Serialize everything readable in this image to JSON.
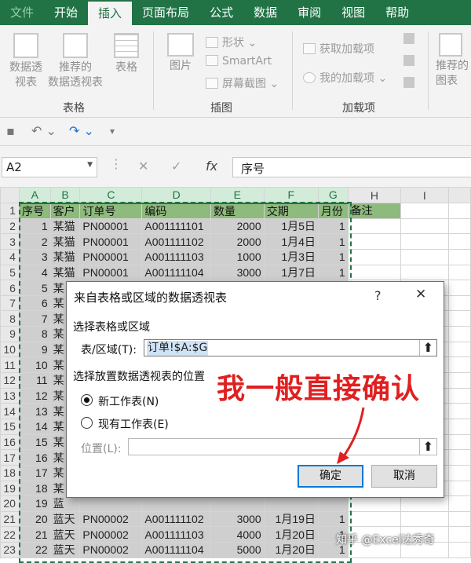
{
  "ribbon_tabs": [
    "文件",
    "开始",
    "插入",
    "页面布局",
    "公式",
    "数据",
    "审阅",
    "视图",
    "帮助"
  ],
  "ribbon": {
    "pivot_table": "数据透\n视表",
    "recommended_pivot": "推荐的\n数据透视表",
    "table": "表格",
    "group_tables": "表格",
    "picture": "图片",
    "shapes": "形状",
    "smartart": "SmartArt",
    "screenshot": "屏幕截图",
    "group_illustrations": "插图",
    "get_addins": "获取加载项",
    "my_addins": "我的加载项",
    "group_addins": "加载项",
    "recommended_charts": "推荐的\n图表"
  },
  "formula_bar": {
    "name_box": "A2",
    "fx": "fx",
    "content": "序号"
  },
  "columns": [
    "A",
    "B",
    "C",
    "D",
    "E",
    "F",
    "G",
    "H",
    "I"
  ],
  "table_headers": [
    "序号",
    "客户",
    "订单号",
    "编码",
    "数量",
    "交期",
    "月份",
    "备注"
  ],
  "rows": [
    [
      "1",
      "某猫",
      "PN00001",
      "A001111101",
      "2000",
      "1月5日",
      "1"
    ],
    [
      "2",
      "某猫",
      "PN00001",
      "A001111102",
      "2000",
      "1月4日",
      "1"
    ],
    [
      "3",
      "某猫",
      "PN00001",
      "A001111103",
      "1000",
      "1月3日",
      "1"
    ],
    [
      "4",
      "某猫",
      "PN00001",
      "A001111104",
      "3000",
      "1月7日",
      "1"
    ],
    [
      "5",
      "某",
      "PN00001",
      "A001111105",
      "",
      "1月10日",
      "1"
    ],
    [
      "6",
      "某",
      "",
      "",
      "",
      "",
      ""
    ],
    [
      "7",
      "某",
      "",
      "",
      "",
      "",
      ""
    ],
    [
      "8",
      "某",
      "",
      "",
      "",
      "",
      ""
    ],
    [
      "9",
      "某",
      "",
      "",
      "",
      "",
      ""
    ],
    [
      "10",
      "某",
      "",
      "",
      "",
      "",
      ""
    ],
    [
      "11",
      "某",
      "",
      "",
      "",
      "",
      ""
    ],
    [
      "12",
      "某",
      "",
      "",
      "",
      "",
      ""
    ],
    [
      "13",
      "某",
      "",
      "",
      "",
      "",
      ""
    ],
    [
      "14",
      "某",
      "",
      "",
      "",
      "",
      ""
    ],
    [
      "15",
      "某",
      "",
      "",
      "",
      "",
      ""
    ],
    [
      "16",
      "某",
      "",
      "",
      "",
      "",
      ""
    ],
    [
      "17",
      "某",
      "",
      "",
      "",
      "",
      ""
    ],
    [
      "18",
      "某",
      "",
      "",
      "",
      "",
      ""
    ],
    [
      "19",
      "蓝",
      "",
      "",
      "",
      "",
      ""
    ],
    [
      "20",
      "蓝天",
      "PN00002",
      "A001111102",
      "3000",
      "1月19日",
      "1"
    ],
    [
      "21",
      "蓝天",
      "PN00002",
      "A001111103",
      "4000",
      "1月20日",
      "1"
    ],
    [
      "22",
      "蓝天",
      "PN00002",
      "A001111104",
      "5000",
      "1月20日",
      "1"
    ],
    [
      "23",
      "蓝天",
      "PN00002",
      "A001111105",
      "6000",
      "1月15日",
      "1"
    ]
  ],
  "dialog": {
    "title": "来自表格或区域的数据透视表",
    "help": "?",
    "close": "✕",
    "section1": "选择表格或区域",
    "range_label": "表/区域(T):",
    "range_value": "订单!$A:$G",
    "section2": "选择放置数据透视表的位置",
    "option_new": "新工作表(N)",
    "option_existing": "现有工作表(E)",
    "location_label": "位置(L):",
    "ok": "确定",
    "cancel": "取消"
  },
  "annotation": "我一般直接确认",
  "watermark": "知乎 @Excel达秀奇",
  "colors": {
    "ribbon_green": "#217346",
    "header_fill": "#8fba7e",
    "annotation_red": "#e02020"
  }
}
